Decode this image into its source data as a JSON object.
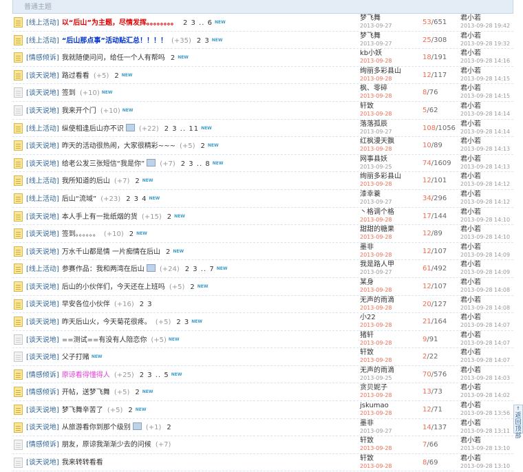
{
  "section_header": "普通主题",
  "back_to_top": {
    "arrow": "↑",
    "label": "返回顶部"
  },
  "threads": [
    {
      "cat": "[线上活动]",
      "title": "以“后山”为主题，尽情发挥。。。。。。。。",
      "style": "red",
      "plus": "",
      "pages": "2 3 .. 6",
      "img": false,
      "new": true,
      "author": "梦飞舞",
      "date": "2013-09-27",
      "hot": false,
      "replies": "53",
      "views": "651",
      "last_user": "君小若",
      "last_time": "2013-09-28 19:42",
      "icon": "folder"
    },
    {
      "cat": "[线上活动]",
      "title": "“后山那点事”活动贴汇总！！！！",
      "style": "blue",
      "plus": "(+35)",
      "pages": "2 3",
      "img": false,
      "new": true,
      "author": "梦飞舞",
      "date": "2013-09-27",
      "hot": false,
      "replies": "25",
      "views": "308",
      "last_user": "君小若",
      "last_time": "2013-09-28 19:32",
      "icon": "folder"
    },
    {
      "cat": "[情感倾诉]",
      "title": "我就随便问问，给任一个人有帮吗",
      "style": "",
      "plus": "",
      "pages": "2",
      "img": false,
      "new": true,
      "author": "kb小妖",
      "date": "2013-09-28",
      "hot": true,
      "replies": "18",
      "views": "191",
      "last_user": "君小若",
      "last_time": "2013-09-28 14:16",
      "icon": "folder"
    },
    {
      "cat": "[谈天说地]",
      "title": "路过看看",
      "style": "",
      "plus": "(+5)",
      "pages": "2",
      "img": false,
      "new": true,
      "author": "绚丽多彩县山",
      "date": "2013-09-28",
      "hot": true,
      "replies": "12",
      "views": "117",
      "last_user": "君小若",
      "last_time": "2013-09-28 14:15",
      "icon": "folder"
    },
    {
      "cat": "[谈天说地]",
      "title": "签到",
      "style": "",
      "plus": "(+10)",
      "pages": "",
      "img": false,
      "new": true,
      "author": "枫、零碎",
      "date": "2013-09-28",
      "hot": true,
      "replies": "8",
      "views": "76",
      "last_user": "君小若",
      "last_time": "2013-09-28 14:15",
      "icon": "plain"
    },
    {
      "cat": "[谈天说地]",
      "title": "我来开个门",
      "style": "",
      "plus": "(+10)",
      "pages": "",
      "img": false,
      "new": true,
      "author": "轩致",
      "date": "2013-09-28",
      "hot": true,
      "replies": "5",
      "views": "62",
      "last_user": "君小若",
      "last_time": "2013-09-28 14:14",
      "icon": "plain"
    },
    {
      "cat": "[线上活动]",
      "title": "纵使相逢后山亦不识",
      "style": "",
      "plus": "(+22)",
      "pages": "2 3 .. 11",
      "img": true,
      "new": true,
      "author": "落落孤辰",
      "date": "2013-09-27",
      "hot": false,
      "replies": "108",
      "views": "1056",
      "last_user": "君小若",
      "last_time": "2013-09-28 14:14",
      "icon": "folder"
    },
    {
      "cat": "[谈天说地]",
      "title": "昨天的活动很热闹，大家很精彩~~~",
      "style": "",
      "plus": "(+5)",
      "pages": "2",
      "img": false,
      "new": true,
      "author": "红枫漫天飘",
      "date": "2013-09-28",
      "hot": true,
      "replies": "10",
      "views": "89",
      "last_user": "君小若",
      "last_time": "2013-09-28 14:13",
      "icon": "folder"
    },
    {
      "cat": "[谈天说地]",
      "title": "给老公发三张短信“我是你”",
      "style": "",
      "plus": "(+7)",
      "pages": "2 3 .. 8",
      "img": true,
      "new": true,
      "author": "网事县妖",
      "date": "2013-09-25",
      "hot": false,
      "replies": "74",
      "views": "1609",
      "last_user": "君小若",
      "last_time": "2013-09-28 14:13",
      "icon": "folder"
    },
    {
      "cat": "[线上活动]",
      "title": "我所知道的后山",
      "style": "",
      "plus": "(+7)",
      "pages": "2",
      "img": false,
      "new": true,
      "author": "绚丽多彩县山",
      "date": "2013-09-28",
      "hot": true,
      "replies": "12",
      "views": "101",
      "last_user": "君小若",
      "last_time": "2013-09-28 14:12",
      "icon": "folder"
    },
    {
      "cat": "[线上活动]",
      "title": "后山“流域”",
      "style": "",
      "plus": "(+23)",
      "pages": "2 3 4",
      "img": false,
      "new": true,
      "author": "漆幸蓑",
      "date": "2013-09-27",
      "hot": false,
      "replies": "34",
      "views": "296",
      "last_user": "君小若",
      "last_time": "2013-09-28 14:12",
      "icon": "folder"
    },
    {
      "cat": "[谈天说地]",
      "title": "本人手上有一批纸烟的货",
      "style": "",
      "plus": "(+15)",
      "pages": "2",
      "img": false,
      "new": true,
      "author": "丶格调个格",
      "date": "2013-09-28",
      "hot": true,
      "replies": "17",
      "views": "144",
      "last_user": "君小若",
      "last_time": "2013-09-28 14:10",
      "icon": "folder"
    },
    {
      "cat": "[谈天说地]",
      "title": "签到。。。。。。",
      "style": "",
      "plus": "(+10)",
      "pages": "2",
      "img": false,
      "new": true,
      "author": "甜甜的糖果",
      "date": "2013-09-28",
      "hot": true,
      "replies": "12",
      "views": "89",
      "last_user": "君小若",
      "last_time": "2013-09-28 14:10",
      "icon": "folder"
    },
    {
      "cat": "[谈天说地]",
      "title": "万水千山都是情 一片痴情在后山",
      "style": "",
      "plus": "",
      "pages": "2",
      "img": false,
      "new": true,
      "author": "墨非",
      "date": "2013-09-28",
      "hot": true,
      "replies": "12",
      "views": "107",
      "last_user": "君小若",
      "last_time": "2013-09-28 14:09",
      "icon": "folder"
    },
    {
      "cat": "[线上活动]",
      "title": "参赛作品：我和两湾在后山",
      "style": "",
      "plus": "(+24)",
      "pages": "2 3 .. 7",
      "img": true,
      "new": true,
      "author": "我是路人甲",
      "date": "2013-09-27",
      "hot": false,
      "replies": "61",
      "views": "492",
      "last_user": "君小若",
      "last_time": "2013-09-28 14:09",
      "icon": "folder"
    },
    {
      "cat": "[谈天说地]",
      "title": "后山的小伙伴们，今天还在上班吗",
      "style": "",
      "plus": "(+5)",
      "pages": "2",
      "img": false,
      "new": true,
      "author": "某身",
      "date": "2013-09-28",
      "hot": true,
      "replies": "12",
      "views": "107",
      "last_user": "君小若",
      "last_time": "2013-09-28 14:08",
      "icon": "folder"
    },
    {
      "cat": "[谈天说地]",
      "title": "早安各位小伙伴",
      "style": "",
      "plus": "(+16)",
      "pages": "2 3",
      "img": false,
      "new": false,
      "author": "无声的雨滴",
      "date": "2013-09-28",
      "hot": true,
      "replies": "20",
      "views": "127",
      "last_user": "君小若",
      "last_time": "2013-09-28 14:08",
      "icon": "folder"
    },
    {
      "cat": "[谈天说地]",
      "title": "昨天后山火，今天菊花很疼。",
      "style": "",
      "plus": "(+5)",
      "pages": "2 3",
      "img": false,
      "new": true,
      "author": "小22",
      "date": "2013-09-28",
      "hot": true,
      "replies": "21",
      "views": "164",
      "last_user": "君小若",
      "last_time": "2013-09-28 14:07",
      "icon": "folder"
    },
    {
      "cat": "[谈天说地]",
      "title": "==测试==有没有人陪恋你",
      "style": "",
      "plus": "(+5)",
      "pages": "",
      "img": false,
      "new": true,
      "author": "猪轩",
      "date": "2013-09-28",
      "hot": true,
      "replies": "9",
      "views": "91",
      "last_user": "君小若",
      "last_time": "2013-09-28 14:07",
      "icon": "plain"
    },
    {
      "cat": "[谈天说地]",
      "title": "父子打赌",
      "style": "",
      "plus": "",
      "pages": "",
      "img": false,
      "new": true,
      "author": "轩致",
      "date": "2013-09-28",
      "hot": true,
      "replies": "2",
      "views": "22",
      "last_user": "君小若",
      "last_time": "2013-09-28 14:07",
      "icon": "plain"
    },
    {
      "cat": "[情感倾诉]",
      "title": "原谅看得懂得人",
      "style": "pink",
      "plus": "(+25)",
      "pages": "2 3 .. 5",
      "img": false,
      "new": true,
      "author": "无声的雨滴",
      "date": "2013-09-25",
      "hot": false,
      "replies": "70",
      "views": "576",
      "last_user": "君小若",
      "last_time": "2013-09-28 14:03",
      "icon": "folder"
    },
    {
      "cat": "[情感倾诉]",
      "title": "开帖，送梦飞舞",
      "style": "",
      "plus": "(+5)",
      "pages": "2",
      "img": false,
      "new": true,
      "author": "贪贝妮子",
      "date": "2013-09-28",
      "hot": true,
      "replies": "13",
      "views": "73",
      "last_user": "君小若",
      "last_time": "2013-09-28 14:02",
      "icon": "folder"
    },
    {
      "cat": "[谈天说地]",
      "title": "梦飞舞辛苦了",
      "style": "",
      "plus": "(+5)",
      "pages": "2",
      "img": false,
      "new": true,
      "author": "jskumao",
      "date": "2013-09-28",
      "hot": true,
      "replies": "12",
      "views": "71",
      "last_user": "君小若",
      "last_time": "2013-09-28 13:56",
      "icon": "folder"
    },
    {
      "cat": "[谈天说地]",
      "title": "从旅游看你到那个级别",
      "style": "",
      "plus": "(+1)",
      "pages": "2",
      "img": true,
      "new": false,
      "author": "墨非",
      "date": "2013-09-27",
      "hot": false,
      "replies": "14",
      "views": "137",
      "last_user": "君小若",
      "last_time": "2013-09-28 13:11",
      "icon": "folder"
    },
    {
      "cat": "[情感倾诉]",
      "title": "朋友，原谅我渐渐少去的问候",
      "style": "",
      "plus": "(+7)",
      "pages": "",
      "img": false,
      "new": false,
      "author": "轩致",
      "date": "2013-09-28",
      "hot": true,
      "replies": "7",
      "views": "66",
      "last_user": "君小若",
      "last_time": "2013-09-28 13:10",
      "icon": "plain"
    },
    {
      "cat": "[谈天说地]",
      "title": "我来转转看看",
      "style": "",
      "plus": "",
      "pages": "",
      "img": false,
      "new": false,
      "author": "轩致",
      "date": "2013-09-28",
      "hot": true,
      "replies": "8",
      "views": "69",
      "last_user": "君小若",
      "last_time": "2013-09-28 13:10",
      "icon": "plain"
    }
  ]
}
